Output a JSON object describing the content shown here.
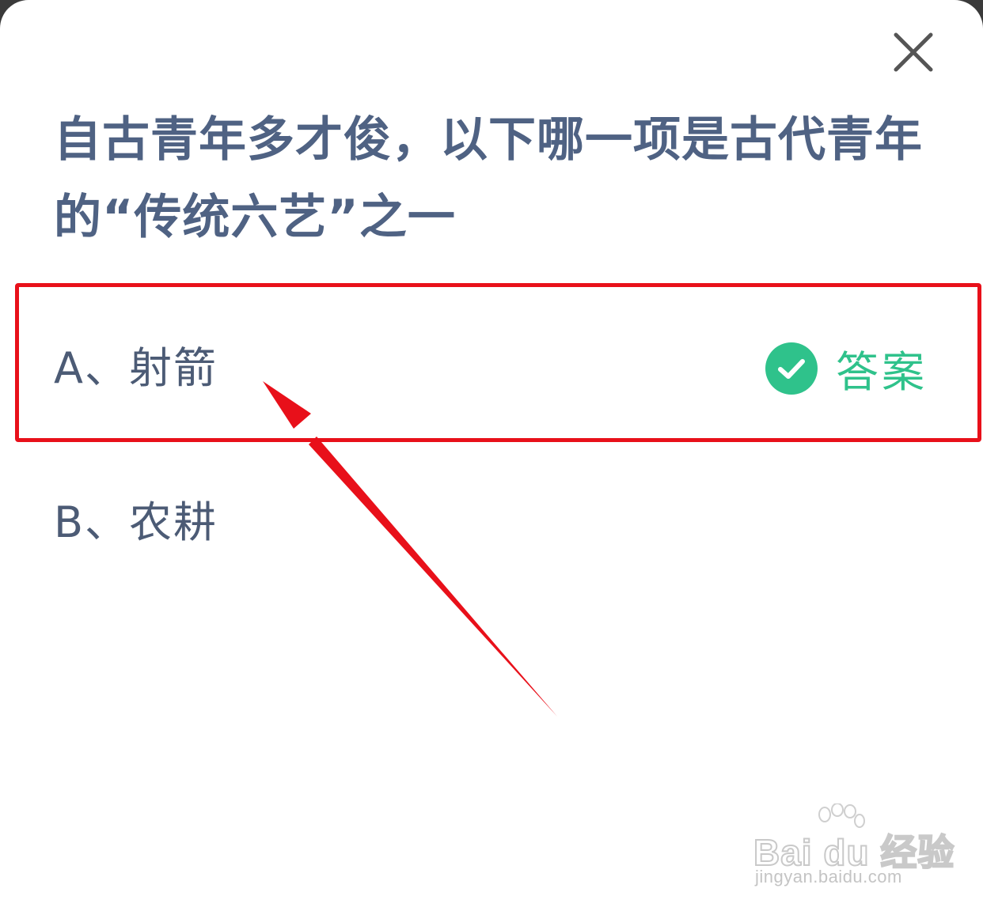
{
  "question": {
    "line1": "自古青年多才俊，以下哪一项是古代青年",
    "line2": "的“传统六艺”之一"
  },
  "options": [
    {
      "label": "A、射箭",
      "is_answer": true
    },
    {
      "label": "B、农耕",
      "is_answer": false
    }
  ],
  "answer_badge": {
    "text": "答案",
    "icon": "check-circle-icon"
  },
  "close_icon": "close-icon",
  "annotation": {
    "highlight_color": "#e8101a",
    "arrow_color": "#e8101a"
  },
  "watermark": {
    "logo": "Bai  du 经验",
    "url": "jingyan.baidu.com"
  },
  "colors": {
    "question_text": "#4f6283",
    "option_text": "#4c5b75",
    "answer_green": "#2fc28b",
    "background": "#ffffff"
  }
}
